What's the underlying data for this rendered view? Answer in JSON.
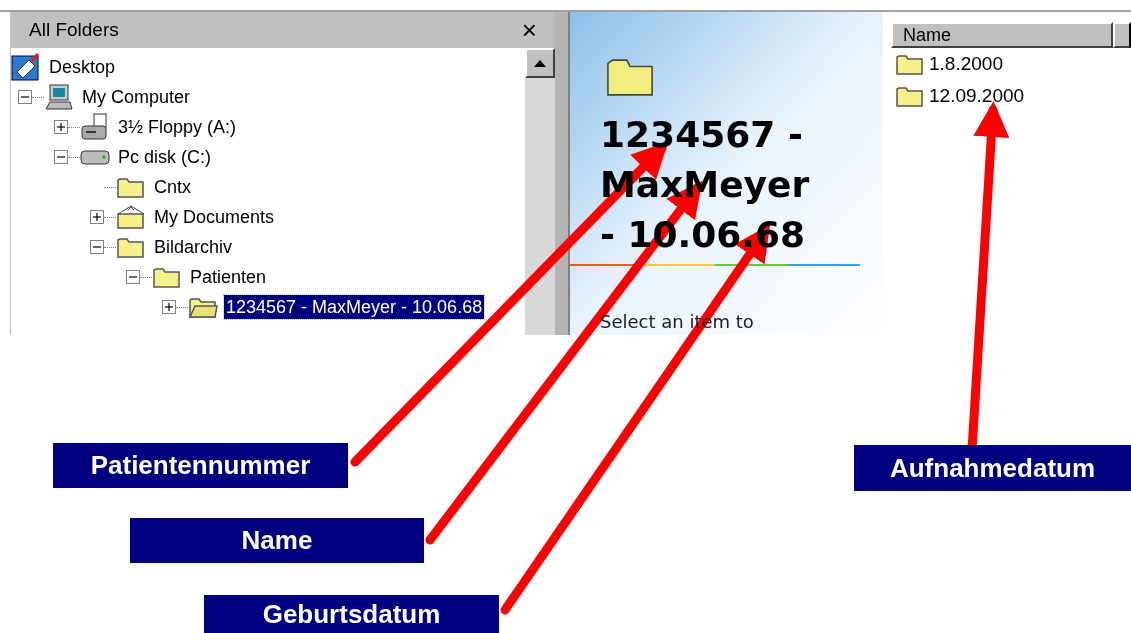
{
  "folders_pane": {
    "title": "All Folders",
    "close": "×",
    "tree": [
      {
        "label": "Desktop",
        "kind": "desktop",
        "selected": false,
        "children": [
          {
            "label": "My Computer",
            "kind": "computer",
            "expanded": true,
            "selected": false,
            "children": [
              {
                "label": "3½ Floppy (A:)",
                "kind": "floppy",
                "expanded": false,
                "selected": false
              },
              {
                "label": "Pc disk (C:)",
                "kind": "disk",
                "expanded": true,
                "selected": false,
                "children": [
                  {
                    "label": "Cntx",
                    "kind": "folder",
                    "selected": false
                  },
                  {
                    "label": "My Documents",
                    "kind": "documents",
                    "expanded": false,
                    "selected": false
                  },
                  {
                    "label": "Bildarchiv",
                    "kind": "folder",
                    "expanded": true,
                    "selected": false,
                    "children": [
                      {
                        "label": "Patienten",
                        "kind": "folder",
                        "expanded": true,
                        "selected": false,
                        "children": [
                          {
                            "label": "1234567 - MaxMeyer - 10.06.68",
                            "kind": "open-folder",
                            "expanded": false,
                            "selected": true
                          }
                        ]
                      }
                    ]
                  }
                ]
              }
            ]
          }
        ]
      }
    ]
  },
  "info_pane": {
    "title": "1234567 - MaxMeyer - 10.06.68",
    "hint": "Select an item to"
  },
  "list": {
    "columns": [
      "Name"
    ],
    "items": [
      "1.8.2000",
      "12.09.2000"
    ]
  },
  "annotations": [
    {
      "label": "Patientennummer"
    },
    {
      "label": "Name"
    },
    {
      "label": "Geburtsdatum"
    },
    {
      "label": "Aufnahmedatum"
    }
  ]
}
